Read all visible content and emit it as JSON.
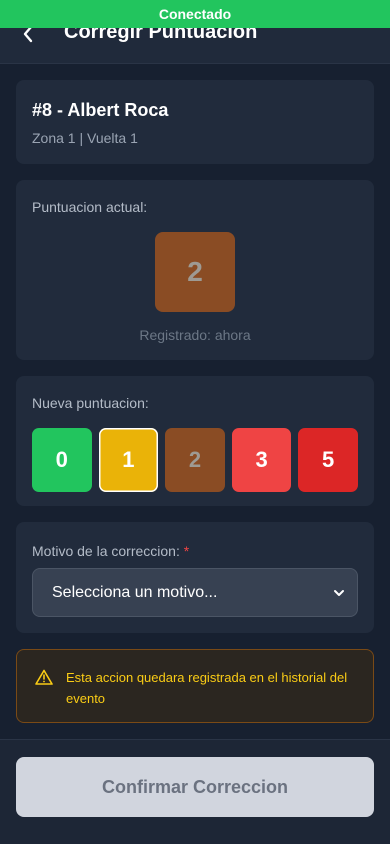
{
  "connection": {
    "status": "Conectado",
    "color": "#22c55e"
  },
  "header": {
    "back_icon": "chevron-left-icon",
    "title": "Corregir Puntuacion"
  },
  "rider": {
    "name": "#8 - Albert Roca",
    "details": "Zona 1 | Vuelta 1"
  },
  "current_score": {
    "label": "Puntuacion actual:",
    "value": "2",
    "color": "#8a4c24",
    "registered": "Registrado: ahora"
  },
  "new_score": {
    "label": "Nueva puntuacion:",
    "options": [
      {
        "value": "0",
        "color": "#22c55e",
        "state": "available"
      },
      {
        "value": "1",
        "color": "#eab308",
        "state": "selected"
      },
      {
        "value": "2",
        "color": "#8a4c24",
        "state": "current"
      },
      {
        "value": "3",
        "color": "#ef4444",
        "state": "available"
      },
      {
        "value": "5",
        "color": "#dc2626",
        "state": "available"
      }
    ]
  },
  "reason": {
    "label": "Motivo de la correccion:",
    "required_mark": "*",
    "selected": "Selecciona un motivo...",
    "icon": "chevron-down-icon"
  },
  "warning": {
    "icon": "warning-triangle-icon",
    "text": "Esta accion quedara registrada en el historial del evento"
  },
  "footer": {
    "confirm_label": "Confirmar Correccion"
  }
}
